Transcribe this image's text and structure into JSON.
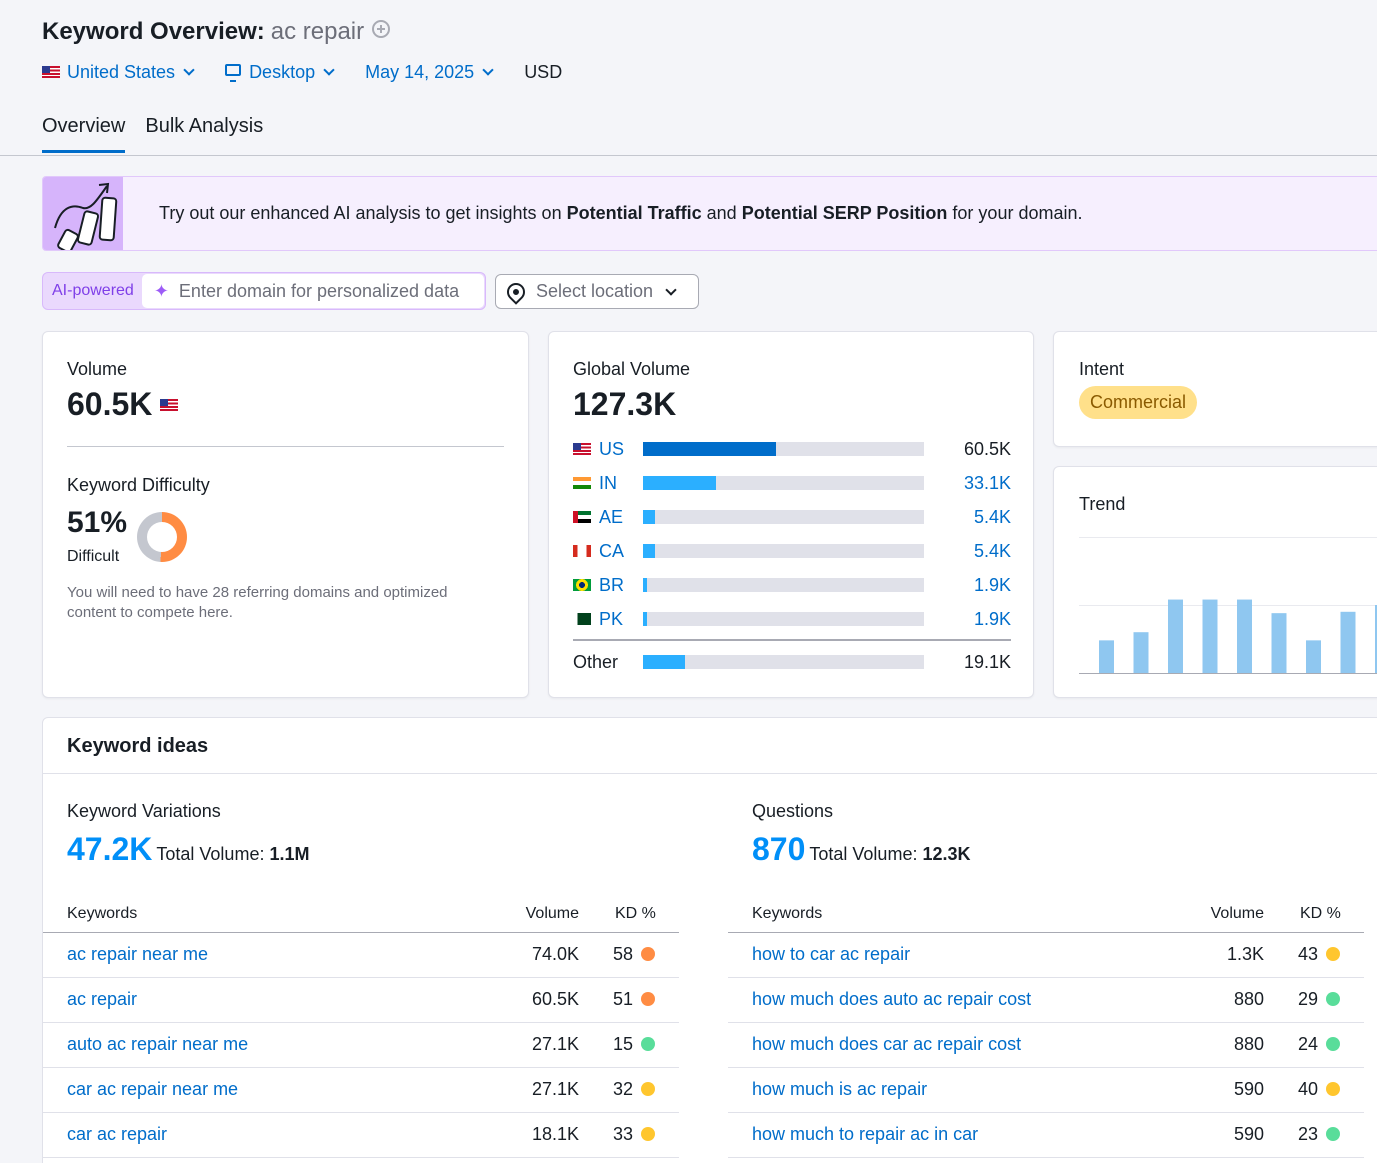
{
  "header": {
    "title": "Keyword Overview:",
    "keyword": "ac repair",
    "filters": {
      "country": "United States",
      "device": "Desktop",
      "date": "May 14, 2025",
      "currency": "USD"
    },
    "tabs": [
      "Overview",
      "Bulk Analysis"
    ]
  },
  "banner": {
    "text_prefix": "Try out our enhanced AI analysis to get insights on",
    "bold1": "Potential Traffic",
    "middle": "and",
    "bold2": "Potential SERP Position",
    "suffix": "for your domain."
  },
  "ai": {
    "badge": "AI-powered",
    "placeholder": "Enter domain for personalized data",
    "location_placeholder": "Select location"
  },
  "volume": {
    "label": "Volume",
    "value": "60.5K"
  },
  "difficulty": {
    "label": "Keyword Difficulty",
    "value": "51%",
    "percent": 51,
    "level": "Difficult",
    "note": "You will need to have 28 referring domains and optimized content to compete here."
  },
  "global_volume": {
    "label": "Global Volume",
    "value": "127.3K",
    "rows": [
      {
        "code": "US",
        "value": "60.5K",
        "share": 0.475
      },
      {
        "code": "IN",
        "value": "33.1K",
        "share": 0.26
      },
      {
        "code": "AE",
        "value": "5.4K",
        "share": 0.042
      },
      {
        "code": "CA",
        "value": "5.4K",
        "share": 0.042
      },
      {
        "code": "BR",
        "value": "1.9K",
        "share": 0.015
      },
      {
        "code": "PK",
        "value": "1.9K",
        "share": 0.015
      }
    ],
    "other": {
      "label": "Other",
      "value": "19.1K",
      "share": 0.15
    }
  },
  "intent": {
    "label": "Intent",
    "value": "Commercial"
  },
  "trend": {
    "label": "Trend",
    "values": [
      0.24,
      0.3,
      0.54,
      0.54,
      0.54,
      0.44,
      0.24,
      0.45,
      0.5
    ]
  },
  "keyword_ideas": {
    "title": "Keyword ideas",
    "variations": {
      "label": "Keyword Variations",
      "count": "47.2K",
      "total_label": "Total Volume:",
      "total": "1.1M",
      "columns": [
        "Keywords",
        "Volume",
        "KD %"
      ],
      "rows": [
        {
          "keyword": "ac repair near me",
          "volume": "74.0K",
          "kd": "58",
          "kd_color": "#ff8c43"
        },
        {
          "keyword": "ac repair",
          "volume": "60.5K",
          "kd": "51",
          "kd_color": "#ff8c43"
        },
        {
          "keyword": "auto ac repair near me",
          "volume": "27.1K",
          "kd": "15",
          "kd_color": "#59dd9a"
        },
        {
          "keyword": "car ac repair near me",
          "volume": "27.1K",
          "kd": "32",
          "kd_color": "#ffc62e"
        },
        {
          "keyword": "car ac repair",
          "volume": "18.1K",
          "kd": "33",
          "kd_color": "#ffc62e"
        }
      ]
    },
    "questions": {
      "label": "Questions",
      "count": "870",
      "total_label": "Total Volume:",
      "total": "12.3K",
      "columns": [
        "Keywords",
        "Volume",
        "KD %"
      ],
      "rows": [
        {
          "keyword": "how to car ac repair",
          "volume": "1.3K",
          "kd": "43",
          "kd_color": "#ffc62e"
        },
        {
          "keyword": "how much does auto ac repair cost",
          "volume": "880",
          "kd": "29",
          "kd_color": "#59dd9a"
        },
        {
          "keyword": "how much does car ac repair cost",
          "volume": "880",
          "kd": "24",
          "kd_color": "#59dd9a"
        },
        {
          "keyword": "how much is ac repair",
          "volume": "590",
          "kd": "40",
          "kd_color": "#ffc62e"
        },
        {
          "keyword": "how much to repair ac in car",
          "volume": "590",
          "kd": "23",
          "kd_color": "#59dd9a"
        }
      ]
    }
  },
  "colors": {
    "link": "#006dca",
    "bar_primary": "#006dca",
    "bar_secondary": "#2bafff",
    "trend_bar": "#8fc7f0",
    "kd_hard": "#ff8c43",
    "kd_medium": "#ffc62e",
    "kd_easy": "#59dd9a"
  }
}
